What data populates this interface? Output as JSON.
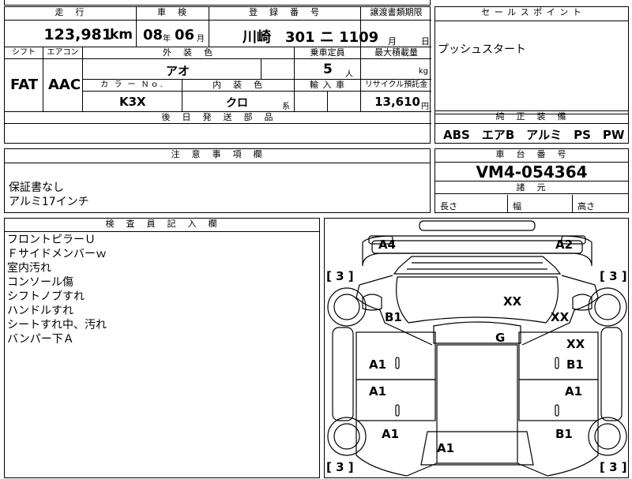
{
  "top_row": {
    "distance": {
      "label": "走　行",
      "value": "123,981",
      "unit": "km"
    },
    "inspection": {
      "label": "車　検",
      "year": "08",
      "year_unit": "年",
      "month": "06",
      "month_unit": "月"
    },
    "registration": {
      "label": "登　録　番　号",
      "value": "川崎　301 ニ 1109"
    },
    "transfer_deadline": {
      "label": "譲渡書類期限",
      "month_unit": "月",
      "day_unit": "日"
    }
  },
  "mid_row": {
    "shift": {
      "label": "シフト",
      "value": "FAT"
    },
    "aircon": {
      "label": "エアコン",
      "value": "AAC"
    },
    "exterior_color": {
      "label": "外　装　色",
      "value": "アオ"
    },
    "capacity": {
      "label": "乗車定員",
      "value": "5",
      "unit": "人"
    },
    "max_load": {
      "label": "最大積載量",
      "unit": "kg"
    },
    "color_no": {
      "label": "カ ラ ー Ｎｏ.",
      "value": "K3X"
    },
    "interior_color": {
      "label": "内　装　色",
      "value": "クロ",
      "suffix": "系"
    },
    "import": {
      "label": "輸 入 車"
    },
    "recycle": {
      "label": "リサイクル預託金",
      "value": "13,610",
      "unit": "円"
    },
    "later_parts": {
      "label": "後　日　発　送　部　品"
    }
  },
  "sales_point": {
    "label": "セ ー ル ス ポ イ ン ト",
    "value": "プッシュスタート"
  },
  "standard_equipment": {
    "label": "純　正　装　備",
    "value": "ABS　エアB　アルミ　PS　PW"
  },
  "notes": {
    "label": "注　意　事　項　欄",
    "lines": [
      "保証書なし",
      "アルミ17インチ"
    ]
  },
  "chassis": {
    "label": "車　台　番　号",
    "value": "VM4-054364"
  },
  "dimensions": {
    "label": "諸　元",
    "length": "長さ",
    "width": "幅",
    "height": "高さ"
  },
  "inspector": {
    "label": "検　査　員　記　入　欄",
    "lines": [
      "フロントピラーＵ",
      "Ｆサイドメンバーｗ",
      "室内汚れ",
      "コンソール傷",
      "シフトノブすれ",
      "ハンドルすれ",
      "シートすれ中、汚れ",
      "バンパー下Ａ"
    ]
  },
  "diagram": {
    "marks": {
      "a4": "A4",
      "a2": "A2",
      "xx1": "XX",
      "xx2": "XX",
      "xx3": "XX",
      "g": "G",
      "b1_left": "B1",
      "b1_right": "B1",
      "b1_rear": "B1",
      "a1_l1": "A1",
      "a1_l2": "A1",
      "a1_l3": "A1",
      "a1_r": "A1",
      "a1_bottom": "A1"
    },
    "tire_labels": {
      "fl": "[ 3 ]",
      "fr": "[ 3 ]",
      "rl": "[ 3 ]",
      "rr": "[ 3 ]"
    }
  }
}
